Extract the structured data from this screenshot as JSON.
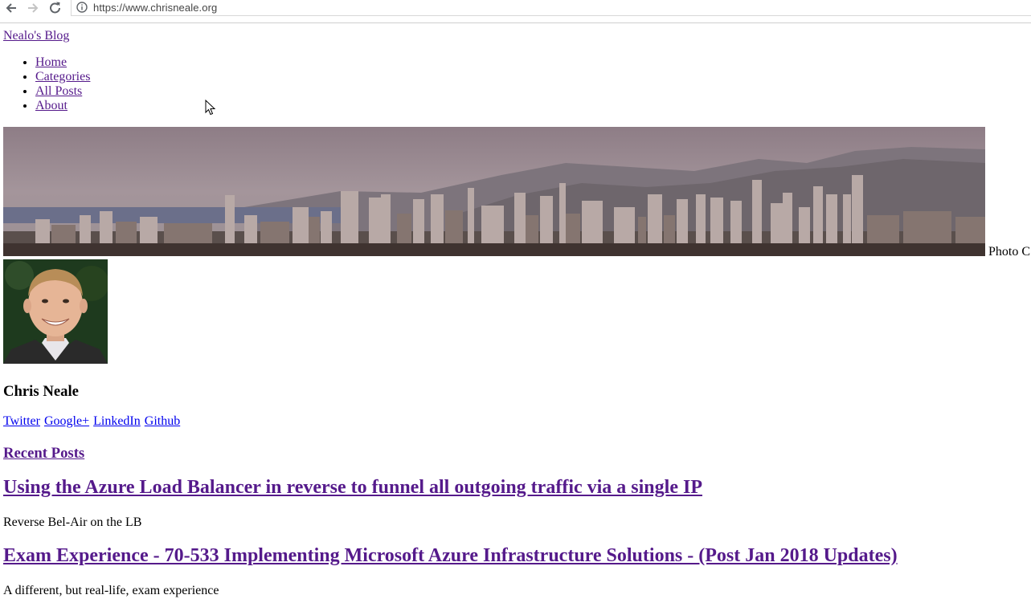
{
  "browser": {
    "url": "https://www.chrisneale.org",
    "back_icon": "back-arrow-icon",
    "forward_icon": "forward-arrow-icon",
    "reload_icon": "reload-icon",
    "info_icon": "info-icon"
  },
  "site": {
    "title": "Nealo's Blog"
  },
  "menu": {
    "items": [
      "Home",
      "Categories",
      "All Posts",
      "About"
    ]
  },
  "banner": {
    "photo_credit": "Photo C"
  },
  "author": {
    "name": "Chris Neale",
    "links": [
      "Twitter",
      "Google+",
      "LinkedIn",
      "Github"
    ]
  },
  "recent_posts": {
    "heading": "Recent Posts",
    "posts": [
      {
        "title": "Using the Azure Load Balancer in reverse to funnel all outgoing traffic via a single IP",
        "subtitle": "Reverse Bel-Air on the LB"
      },
      {
        "title": "Exam Experience - 70-533 Implementing Microsoft Azure Infrastructure Solutions - (Post Jan 2018 Updates)",
        "subtitle": "A different, but real-life, exam experience"
      }
    ]
  },
  "colors": {
    "link_visited": "#551a8b",
    "link_unvisited": "#0000ee"
  }
}
